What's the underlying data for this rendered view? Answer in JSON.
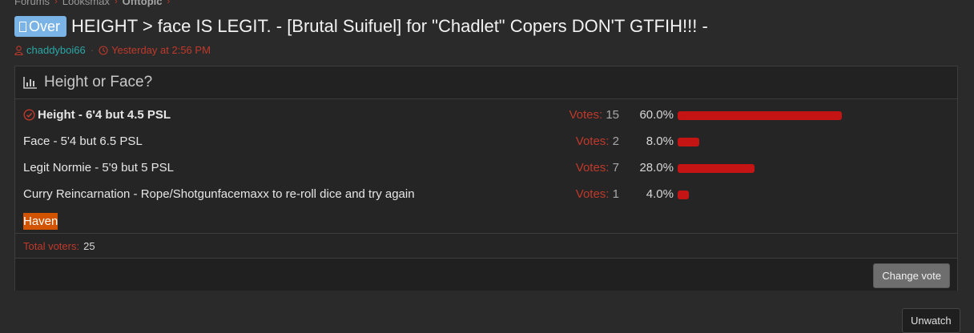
{
  "breadcrumb": {
    "items": [
      "Forums",
      "Looksmax",
      "Offtopic"
    ],
    "separator": "›"
  },
  "thread": {
    "prefix": "Over",
    "title": "HEIGHT > face IS LEGIT. - [Brutal Suifuel] for \"Chadlet\" Copers DON'T GTFIH!!! -",
    "author": "chaddyboi66",
    "time": "Yesterday at 2:56 PM"
  },
  "poll": {
    "title": "Height or Face?",
    "votes_label": "Votes:",
    "options": [
      {
        "label": "Height - 6'4 but 4.5 PSL",
        "votes": "15",
        "percent": "60.0%",
        "fraction": 0.6,
        "winner": true
      },
      {
        "label": "Face - 5'4 but 6.5 PSL",
        "votes": "2",
        "percent": "8.0%",
        "fraction": 0.08,
        "winner": false
      },
      {
        "label": "Legit Normie - 5'9 but 5 PSL",
        "votes": "7",
        "percent": "28.0%",
        "fraction": 0.28,
        "winner": false
      },
      {
        "label": "Curry Reincarnation - Rope/Shotgunfacemaxx to re-roll dice and try again",
        "votes": "1",
        "percent": "4.0%",
        "fraction": 0.04,
        "winner": false
      }
    ],
    "highlight_tag": "Haven",
    "total_voters_label": "Total voters:",
    "total_voters": "25",
    "change_vote_label": "Change vote"
  },
  "actions": {
    "unwatch_label": "Unwatch"
  },
  "colors": {
    "bar": "#c41414",
    "accent_red": "#c0392b",
    "user_teal": "#2aa6a6",
    "prefix_blue": "#7ab3e6",
    "haven_orange": "#d35400"
  }
}
